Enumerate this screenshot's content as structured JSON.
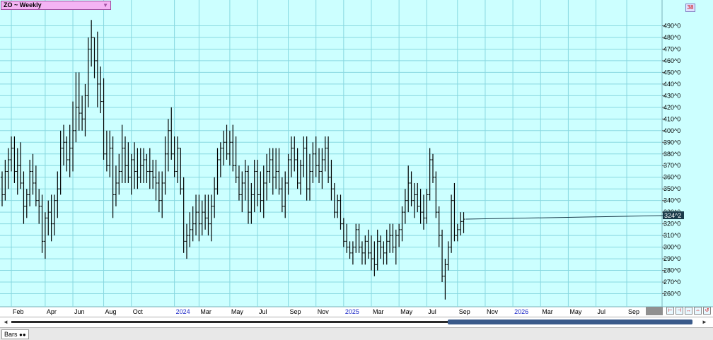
{
  "title": "ZO ~ Weekly",
  "corner_badge": "38",
  "bottom_tab": "Bars",
  "last_price": "324^2",
  "colors": {
    "background": "#ccffff",
    "grid": "#88d8e0",
    "bars": "#000000",
    "title_bg": "#f4b4f4",
    "year_label": "#1c28c8",
    "last_price_bg": "#1a3a4a"
  },
  "chart_data": {
    "type": "ohlc",
    "title": "ZO ~ Weekly",
    "xlabel": "",
    "ylabel": "",
    "ylim": [
      250,
      500
    ],
    "y_tick_values": [
      260,
      270,
      280,
      290,
      300,
      310,
      320,
      330,
      340,
      350,
      360,
      370,
      380,
      390,
      400,
      410,
      420,
      430,
      440,
      450,
      460,
      470,
      480,
      490
    ],
    "y_tick_suffix": "^0",
    "x_labels": [
      {
        "label": "Feb",
        "year": false,
        "bar": 3
      },
      {
        "label": "Apr",
        "year": false,
        "bar": 14
      },
      {
        "label": "Jun",
        "year": false,
        "bar": 23
      },
      {
        "label": "Aug",
        "year": false,
        "bar": 33
      },
      {
        "label": "Oct",
        "year": false,
        "bar": 42
      },
      {
        "label": "2024",
        "year": true,
        "bar": 56
      },
      {
        "label": "Mar",
        "year": false,
        "bar": 64
      },
      {
        "label": "May",
        "year": false,
        "bar": 74
      },
      {
        "label": "Jul",
        "year": false,
        "bar": 83
      },
      {
        "label": "Sep",
        "year": false,
        "bar": 93
      },
      {
        "label": "Nov",
        "year": false,
        "bar": 102
      },
      {
        "label": "2025",
        "year": true,
        "bar": 111
      },
      {
        "label": "Mar",
        "year": false,
        "bar": 120
      },
      {
        "label": "May",
        "year": false,
        "bar": 129
      },
      {
        "label": "Jul",
        "year": false,
        "bar": 138
      },
      {
        "label": "Sep",
        "year": false,
        "bar": 148
      },
      {
        "label": "Nov",
        "year": false,
        "bar": 157
      },
      {
        "label": "2026",
        "year": true,
        "bar": 166
      },
      {
        "label": "Mar",
        "year": false,
        "bar": 175
      },
      {
        "label": "May",
        "year": false,
        "bar": 184
      },
      {
        "label": "Jul",
        "year": false,
        "bar": 193
      },
      {
        "label": "Sep",
        "year": false,
        "bar": 203
      }
    ],
    "bars": [
      [
        360,
        365,
        335,
        345
      ],
      [
        345,
        375,
        340,
        365
      ],
      [
        365,
        385,
        350,
        375
      ],
      [
        375,
        395,
        365,
        385
      ],
      [
        385,
        395,
        355,
        365
      ],
      [
        365,
        385,
        345,
        370
      ],
      [
        370,
        390,
        350,
        355
      ],
      [
        355,
        365,
        320,
        335
      ],
      [
        335,
        350,
        325,
        345
      ],
      [
        345,
        375,
        335,
        365
      ],
      [
        365,
        380,
        345,
        355
      ],
      [
        355,
        370,
        335,
        340
      ],
      [
        340,
        350,
        320,
        335
      ],
      [
        335,
        345,
        295,
        305
      ],
      [
        305,
        330,
        290,
        325
      ],
      [
        325,
        340,
        310,
        330
      ],
      [
        330,
        345,
        305,
        320
      ],
      [
        320,
        345,
        310,
        340
      ],
      [
        340,
        365,
        325,
        350
      ],
      [
        350,
        400,
        345,
        385
      ],
      [
        385,
        405,
        370,
        390
      ],
      [
        390,
        395,
        365,
        375
      ],
      [
        375,
        405,
        360,
        385
      ],
      [
        385,
        425,
        365,
        400
      ],
      [
        400,
        450,
        390,
        420
      ],
      [
        420,
        450,
        400,
        415
      ],
      [
        415,
        430,
        400,
        410
      ],
      [
        410,
        440,
        395,
        430
      ],
      [
        430,
        480,
        420,
        470
      ],
      [
        470,
        495,
        455,
        480
      ],
      [
        480,
        480,
        445,
        460
      ],
      [
        460,
        485,
        420,
        440
      ],
      [
        440,
        455,
        415,
        425
      ],
      [
        425,
        445,
        375,
        380
      ],
      [
        380,
        400,
        365,
        370
      ],
      [
        370,
        400,
        360,
        385
      ],
      [
        385,
        395,
        325,
        345
      ],
      [
        345,
        370,
        335,
        355
      ],
      [
        355,
        380,
        345,
        365
      ],
      [
        365,
        405,
        355,
        385
      ],
      [
        385,
        395,
        355,
        370
      ],
      [
        370,
        390,
        355,
        360
      ],
      [
        360,
        380,
        345,
        375
      ],
      [
        375,
        390,
        350,
        365
      ],
      [
        365,
        385,
        350,
        360
      ],
      [
        360,
        385,
        355,
        370
      ],
      [
        370,
        385,
        355,
        375
      ],
      [
        375,
        380,
        355,
        365
      ],
      [
        365,
        385,
        350,
        365
      ],
      [
        365,
        375,
        350,
        360
      ],
      [
        360,
        375,
        340,
        355
      ],
      [
        355,
        365,
        330,
        340
      ],
      [
        340,
        365,
        325,
        355
      ],
      [
        355,
        395,
        345,
        380
      ],
      [
        380,
        410,
        365,
        400
      ],
      [
        400,
        420,
        375,
        380
      ],
      [
        380,
        395,
        360,
        365
      ],
      [
        365,
        395,
        355,
        385
      ],
      [
        385,
        385,
        345,
        350
      ],
      [
        350,
        360,
        295,
        305
      ],
      [
        305,
        320,
        290,
        310
      ],
      [
        310,
        330,
        300,
        315
      ],
      [
        315,
        335,
        305,
        320
      ],
      [
        320,
        345,
        310,
        330
      ],
      [
        330,
        345,
        305,
        320
      ],
      [
        320,
        340,
        310,
        330
      ],
      [
        330,
        345,
        315,
        325
      ],
      [
        325,
        345,
        310,
        320
      ],
      [
        320,
        345,
        305,
        335
      ],
      [
        335,
        360,
        325,
        350
      ],
      [
        350,
        385,
        345,
        375
      ],
      [
        375,
        390,
        360,
        385
      ],
      [
        385,
        400,
        370,
        390
      ],
      [
        390,
        405,
        375,
        380
      ],
      [
        380,
        400,
        370,
        390
      ],
      [
        390,
        405,
        365,
        370
      ],
      [
        370,
        395,
        355,
        360
      ],
      [
        360,
        370,
        340,
        345
      ],
      [
        345,
        365,
        330,
        355
      ],
      [
        355,
        375,
        340,
        365
      ],
      [
        365,
        370,
        320,
        330
      ],
      [
        330,
        355,
        320,
        345
      ],
      [
        345,
        375,
        330,
        365
      ],
      [
        365,
        375,
        335,
        345
      ],
      [
        345,
        365,
        330,
        340
      ],
      [
        340,
        370,
        325,
        355
      ],
      [
        355,
        380,
        340,
        365
      ],
      [
        365,
        385,
        355,
        375
      ],
      [
        375,
        385,
        345,
        360
      ],
      [
        360,
        385,
        350,
        365
      ],
      [
        365,
        385,
        345,
        350
      ],
      [
        350,
        360,
        330,
        335
      ],
      [
        335,
        365,
        325,
        355
      ],
      [
        355,
        380,
        345,
        375
      ],
      [
        375,
        395,
        360,
        385
      ],
      [
        385,
        395,
        365,
        375
      ],
      [
        375,
        385,
        350,
        355
      ],
      [
        355,
        375,
        345,
        370
      ],
      [
        370,
        395,
        360,
        385
      ],
      [
        385,
        395,
        340,
        350
      ],
      [
        350,
        380,
        340,
        365
      ],
      [
        365,
        390,
        355,
        380
      ],
      [
        380,
        395,
        360,
        370
      ],
      [
        370,
        385,
        355,
        365
      ],
      [
        365,
        385,
        350,
        375
      ],
      [
        375,
        395,
        365,
        385
      ],
      [
        385,
        395,
        355,
        360
      ],
      [
        360,
        375,
        340,
        350
      ],
      [
        350,
        355,
        325,
        330
      ],
      [
        330,
        345,
        325,
        340
      ],
      [
        340,
        345,
        315,
        320
      ],
      [
        320,
        325,
        300,
        305
      ],
      [
        305,
        320,
        295,
        300
      ],
      [
        300,
        305,
        290,
        295
      ],
      [
        295,
        305,
        285,
        300
      ],
      [
        300,
        320,
        295,
        315
      ],
      [
        315,
        320,
        295,
        300
      ],
      [
        300,
        305,
        285,
        295
      ],
      [
        295,
        310,
        285,
        305
      ],
      [
        305,
        315,
        290,
        295
      ],
      [
        295,
        310,
        280,
        290
      ],
      [
        290,
        305,
        275,
        285
      ],
      [
        285,
        315,
        280,
        305
      ],
      [
        305,
        310,
        290,
        300
      ],
      [
        300,
        305,
        285,
        295
      ],
      [
        295,
        315,
        285,
        305
      ],
      [
        305,
        320,
        295,
        310
      ],
      [
        310,
        320,
        295,
        300
      ],
      [
        300,
        315,
        285,
        310
      ],
      [
        310,
        320,
        300,
        315
      ],
      [
        315,
        335,
        305,
        330
      ],
      [
        330,
        350,
        320,
        340
      ],
      [
        340,
        370,
        330,
        355
      ],
      [
        355,
        365,
        335,
        340
      ],
      [
        340,
        355,
        325,
        345
      ],
      [
        345,
        355,
        330,
        335
      ],
      [
        335,
        350,
        320,
        330
      ],
      [
        330,
        345,
        315,
        325
      ],
      [
        325,
        350,
        320,
        345
      ],
      [
        345,
        385,
        340,
        375
      ],
      [
        375,
        380,
        355,
        360
      ],
      [
        360,
        365,
        325,
        330
      ],
      [
        330,
        335,
        300,
        310
      ],
      [
        310,
        315,
        270,
        275
      ],
      [
        275,
        290,
        255,
        285
      ],
      [
        285,
        305,
        280,
        300
      ],
      [
        300,
        345,
        295,
        340
      ],
      [
        340,
        355,
        305,
        310
      ],
      [
        310,
        320,
        305,
        315
      ],
      [
        315,
        330,
        310,
        322
      ],
      [
        322,
        330,
        312,
        324
      ]
    ]
  }
}
